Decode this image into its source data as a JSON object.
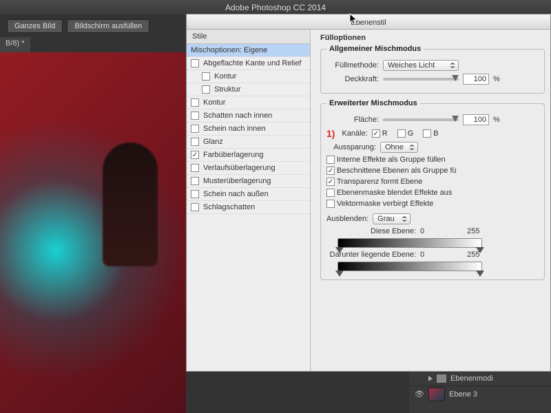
{
  "app_title": "Adobe Photoshop CC 2014",
  "top_buttons": {
    "fit_image": "Ganzes Bild",
    "fill_screen": "Bildschirm ausfüllen"
  },
  "doc_tab": "B/8) *",
  "dialog": {
    "title": "Ebenenstil",
    "styles_header": "Stile",
    "styles": {
      "blend_options": "Mischoptionen: Eigene",
      "bevel_emboss": "Abgeflachte Kante und Relief",
      "contour_sub": "Kontur",
      "texture_sub": "Struktur",
      "stroke": "Kontur",
      "inner_shadow": "Schatten nach innen",
      "inner_glow": "Schein nach innen",
      "satin": "Glanz",
      "color_overlay": "Farbüberlagerung",
      "gradient_overlay": "Verlaufsüberlagerung",
      "pattern_overlay": "Musterüberlagerung",
      "outer_glow": "Schein nach außen",
      "drop_shadow": "Schlagschatten"
    },
    "section_fill": "Füllоptionen",
    "section_general": "Allgemeiner Mischmodus",
    "blend_mode_label": "Füllmethode:",
    "blend_mode_value": "Weiches Licht",
    "opacity_label": "Deckkraft:",
    "opacity_value": "100",
    "pct": "%",
    "section_advanced": "Erweiterter Mischmodus",
    "fill_label": "Fläche:",
    "fill_value": "100",
    "marker": "1)",
    "channels_label": "Kanäle:",
    "ch_r": "R",
    "ch_g": "G",
    "ch_b": "B",
    "knockout_label": "Aussparung:",
    "knockout_value": "Ohne",
    "opt_interior": "Interne Effekte als Gruppe füllen",
    "opt_clipped": "Beschnittene Ebenen als Gruppe fü",
    "opt_transparency": "Transparenz formt Ebene",
    "opt_mask_hides": "Ebenenmaske blendet Effekte aus",
    "opt_vector_hides": "Vektormaske verbirgt Effekte",
    "blendif_label": "Ausblenden:",
    "blendif_value": "Grau",
    "this_layer": "Diese Ebene:",
    "this_min": "0",
    "this_max": "255",
    "underlying": "Darunter liegende Ebene:",
    "under_min": "0",
    "under_max": "255"
  },
  "layers_panel": {
    "group_name": "Ebenenmodi",
    "layer_name": "Ebene 3"
  }
}
